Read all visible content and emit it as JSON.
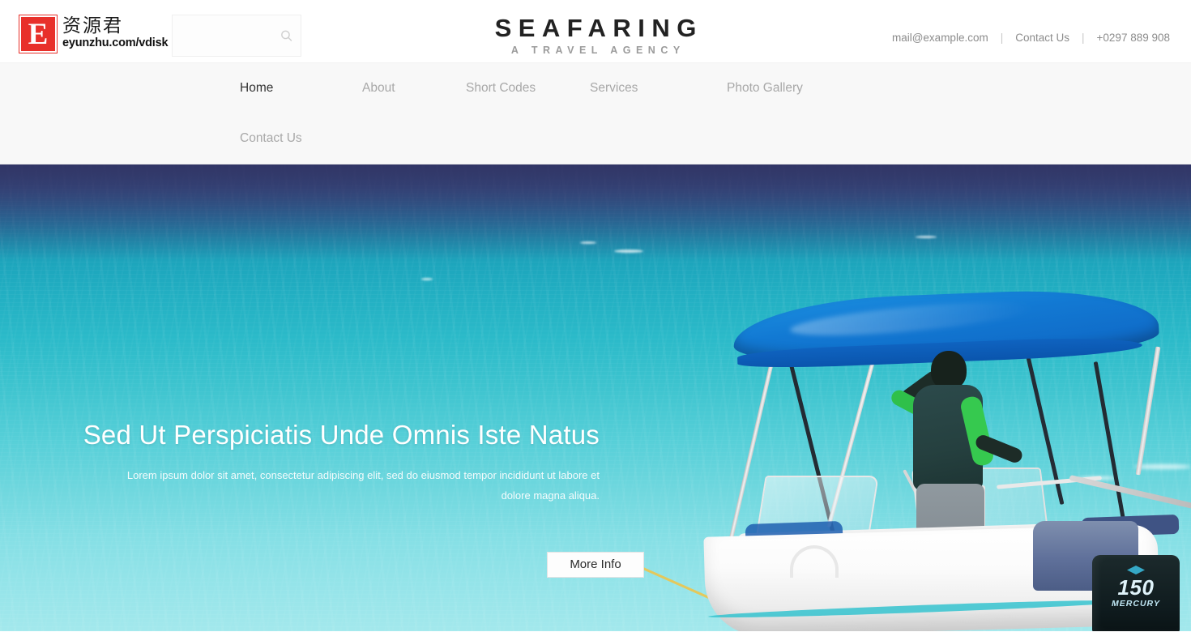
{
  "watermark": {
    "badge_letter": "E",
    "cn_name": "资源君",
    "url": "eyunzhu.com/vdisk"
  },
  "search": {
    "value": "",
    "placeholder": "",
    "icon": "search-icon"
  },
  "brand": {
    "title": "SEAFARING",
    "subtitle": "A TRAVEL AGENCY"
  },
  "contact": {
    "email": "mail@example.com",
    "link": "Contact Us",
    "phone": "+0297 889 908",
    "separator": "|"
  },
  "nav": {
    "items": [
      {
        "label": "Home",
        "active": true
      },
      {
        "label": "About",
        "active": false
      },
      {
        "label": "Short Codes",
        "active": false
      },
      {
        "label": "Services",
        "active": false
      },
      {
        "label": "Photo Gallery",
        "active": false
      },
      {
        "label": "Contact Us",
        "active": false
      }
    ]
  },
  "hero": {
    "title": "Sed Ut Perspiciatis Unde Omnis Iste Natus",
    "subtitle": "Lorem ipsum dolor sit amet, consectetur adipiscing elit, sed do eiusmod tempor incididunt ut labore et dolore magna aliqua.",
    "button_label": "More Info",
    "image_alt": "motorboat-on-turquoise-sea",
    "boat": {
      "motor_model": "150",
      "motor_brand": "MERCURY"
    }
  },
  "colors": {
    "brand_title": "#222222",
    "brand_subtitle": "#9b9b9b",
    "nav_active": "#333333",
    "nav_inactive": "#a8a8a8",
    "nav_background": "#f8f8f8",
    "contact_text": "#8c8c8c",
    "watermark_red": "#e8302a",
    "hero_text": "#ffffff",
    "button_background": "#fdfdfd",
    "water_top": "#3d4a7c",
    "water_bottom": "#a3e8ec",
    "canopy_blue": "#1279d3"
  }
}
